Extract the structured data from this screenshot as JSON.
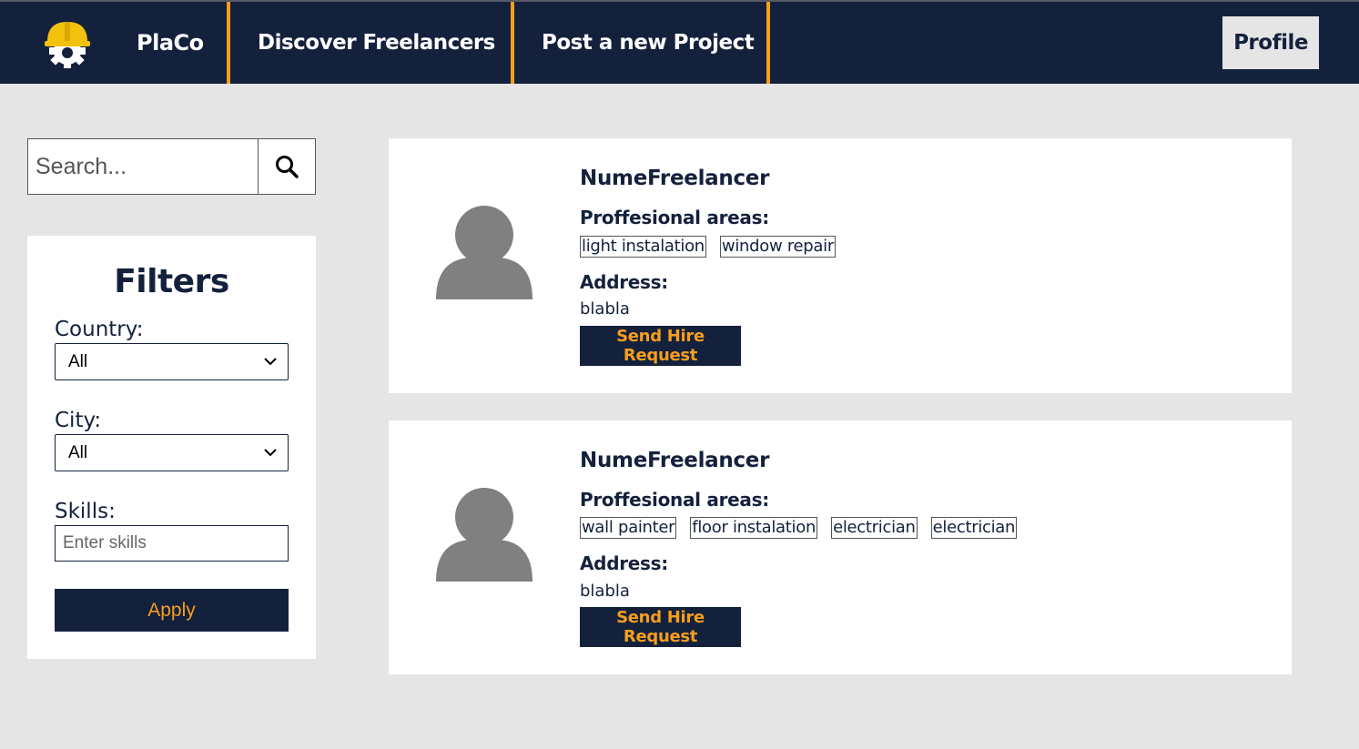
{
  "nav": {
    "brand": "PlaCo",
    "links": [
      "Discover Freelancers",
      "Post a new Project"
    ],
    "profile": "Profile"
  },
  "search": {
    "placeholder": "Search..."
  },
  "filters": {
    "title": "Filters",
    "country_label": "Country:",
    "country_value": "All",
    "city_label": "City:",
    "city_value": "All",
    "skills_label": "Skills:",
    "skills_placeholder": "Enter skills",
    "apply": "Apply"
  },
  "freelancers": [
    {
      "name": "NumeFreelancer",
      "areas_label": "Proffesional areas:",
      "areas": [
        "light instalation",
        "window repair"
      ],
      "address_label": "Address:",
      "address": "blabla",
      "hire": "Send Hire Request"
    },
    {
      "name": "NumeFreelancer",
      "areas_label": "Proffesional areas:",
      "areas": [
        "wall painter",
        "floor instalation",
        "electrician",
        "electrician"
      ],
      "address_label": "Address:",
      "address": "blabla",
      "hire": "Send Hire Request"
    }
  ],
  "colors": {
    "navy": "#14213d",
    "accent": "#f79e1b",
    "background": "#e5e5e5"
  }
}
